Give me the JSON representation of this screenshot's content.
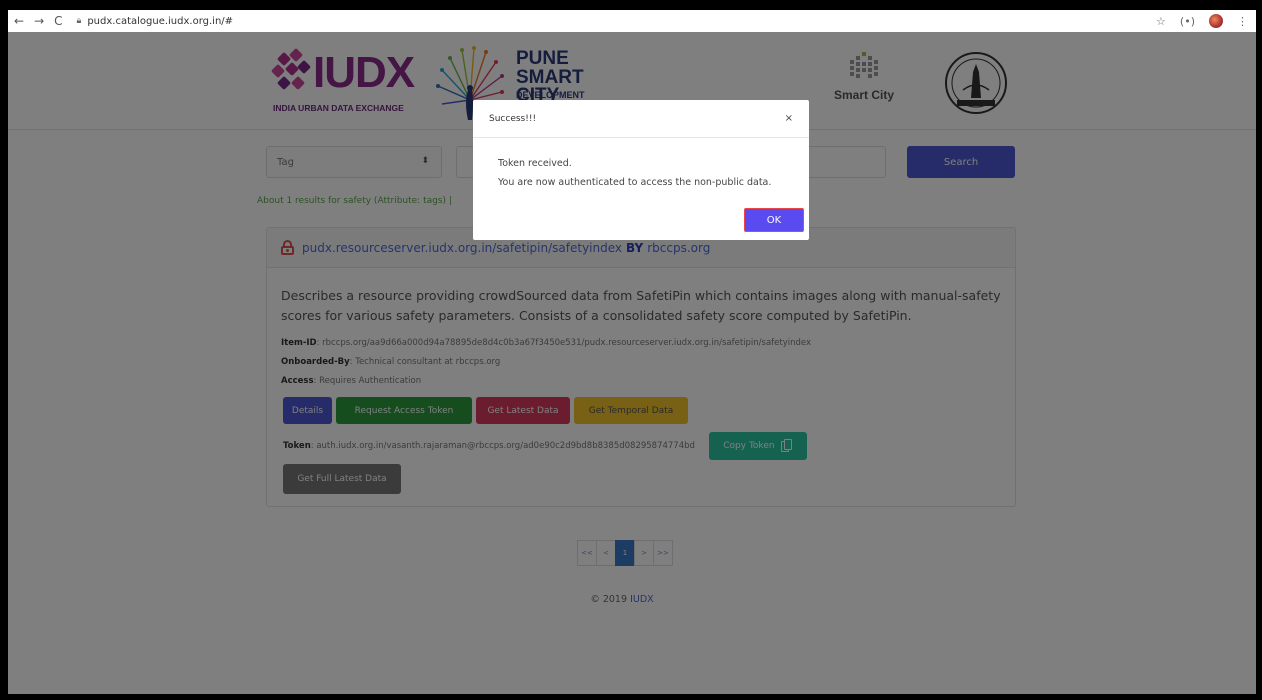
{
  "browser": {
    "url": "pudx.catalogue.iudx.org.in/#"
  },
  "header": {
    "iudx_text": "IUDX",
    "iudx_sub": "INDIA URBAN DATA EXCHANGE",
    "pune_line1": "PUNE",
    "pune_line2": "SMART CITY",
    "pune_line3": "DEVELOPMENT",
    "smart_city": "Smart City"
  },
  "search": {
    "select_value": "Tag",
    "button_label": "Search"
  },
  "results_note": "About 1 results for safety (Attribute: tags) |",
  "card": {
    "id_link": "pudx.resourceserver.iudx.org.in/safetipin/safetyindex",
    "by": "BY",
    "org_link": "rbccps.org",
    "description": "Describes a resource providing crowdSourced data from SafetiPin which contains images along with manual-safety scores for various safety parameters. Consists of a consolidated safety score computed by SafetiPin.",
    "item_id_label": "Item-ID",
    "item_id_value": ": rbccps.org/aa9d66a000d94a78895de8d4c0b3a67f3450e531/pudx.resourceserver.iudx.org.in/safetipin/safetyindex",
    "onboarded_label": "Onboarded-By",
    "onboarded_value": ": Technical consultant at rbccps.org",
    "access_label": "Access",
    "access_value": ": Requires Authentication",
    "buttons": {
      "details": "Details",
      "request_token": "Request Access Token",
      "latest": "Get Latest Data",
      "temporal": "Get Temporal Data",
      "copy_token": "Copy Token",
      "full_latest": "Get Full Latest Data"
    },
    "token_label": "Token",
    "token_value": ": auth.iudx.org.in/vasanth.rajaraman@rbccps.org/ad0e90c2d9bd8b8385d08295874774bd"
  },
  "pagination": {
    "first": "<<",
    "prev": "<",
    "current": "1",
    "next": ">",
    "last": ">>"
  },
  "footer": {
    "copyright": "© 2019",
    "link": "IUDX"
  },
  "modal": {
    "title": "Success!!!",
    "close": "×",
    "line1": "Token received.",
    "line2": "You are now authenticated to access the non-public data.",
    "ok": "OK"
  },
  "colors": {
    "primary": "#4d58d4",
    "success": "#2a9a3c",
    "danger": "#d63a5e",
    "warning": "#f0c02a",
    "teal": "#2bc4a2",
    "gray": "#777777"
  }
}
